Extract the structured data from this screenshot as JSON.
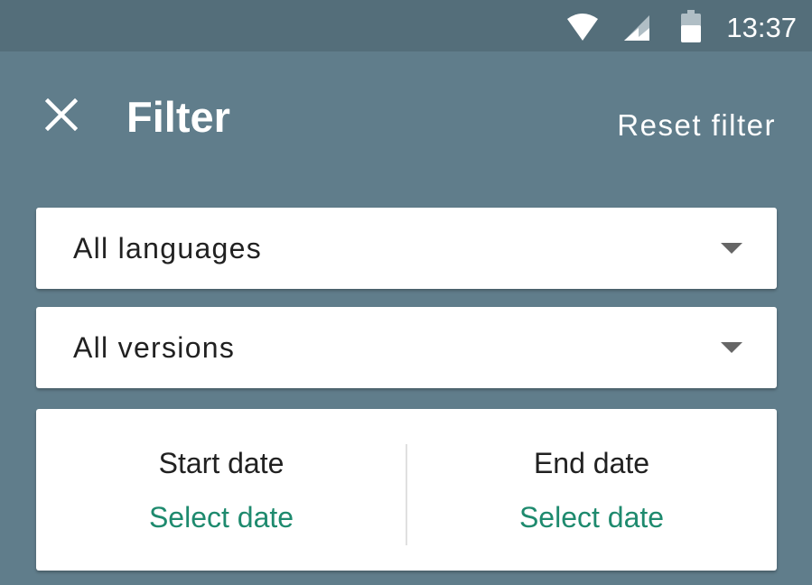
{
  "status_bar": {
    "time": "13:37",
    "icons": [
      "wifi-icon",
      "cell-signal-icon",
      "battery-icon"
    ]
  },
  "toolbar": {
    "close_icon": "close-icon",
    "title": "Filter",
    "reset_label": "Reset filter"
  },
  "filters": {
    "language": {
      "selected": "All languages"
    },
    "version": {
      "selected": "All versions"
    }
  },
  "dates": {
    "start": {
      "label": "Start date",
      "action": "Select date"
    },
    "end": {
      "label": "End date",
      "action": "Select date"
    }
  },
  "colors": {
    "background": "#607d8b",
    "status_bar": "#546e7a",
    "accent": "#1e8a6e",
    "card": "#ffffff"
  }
}
